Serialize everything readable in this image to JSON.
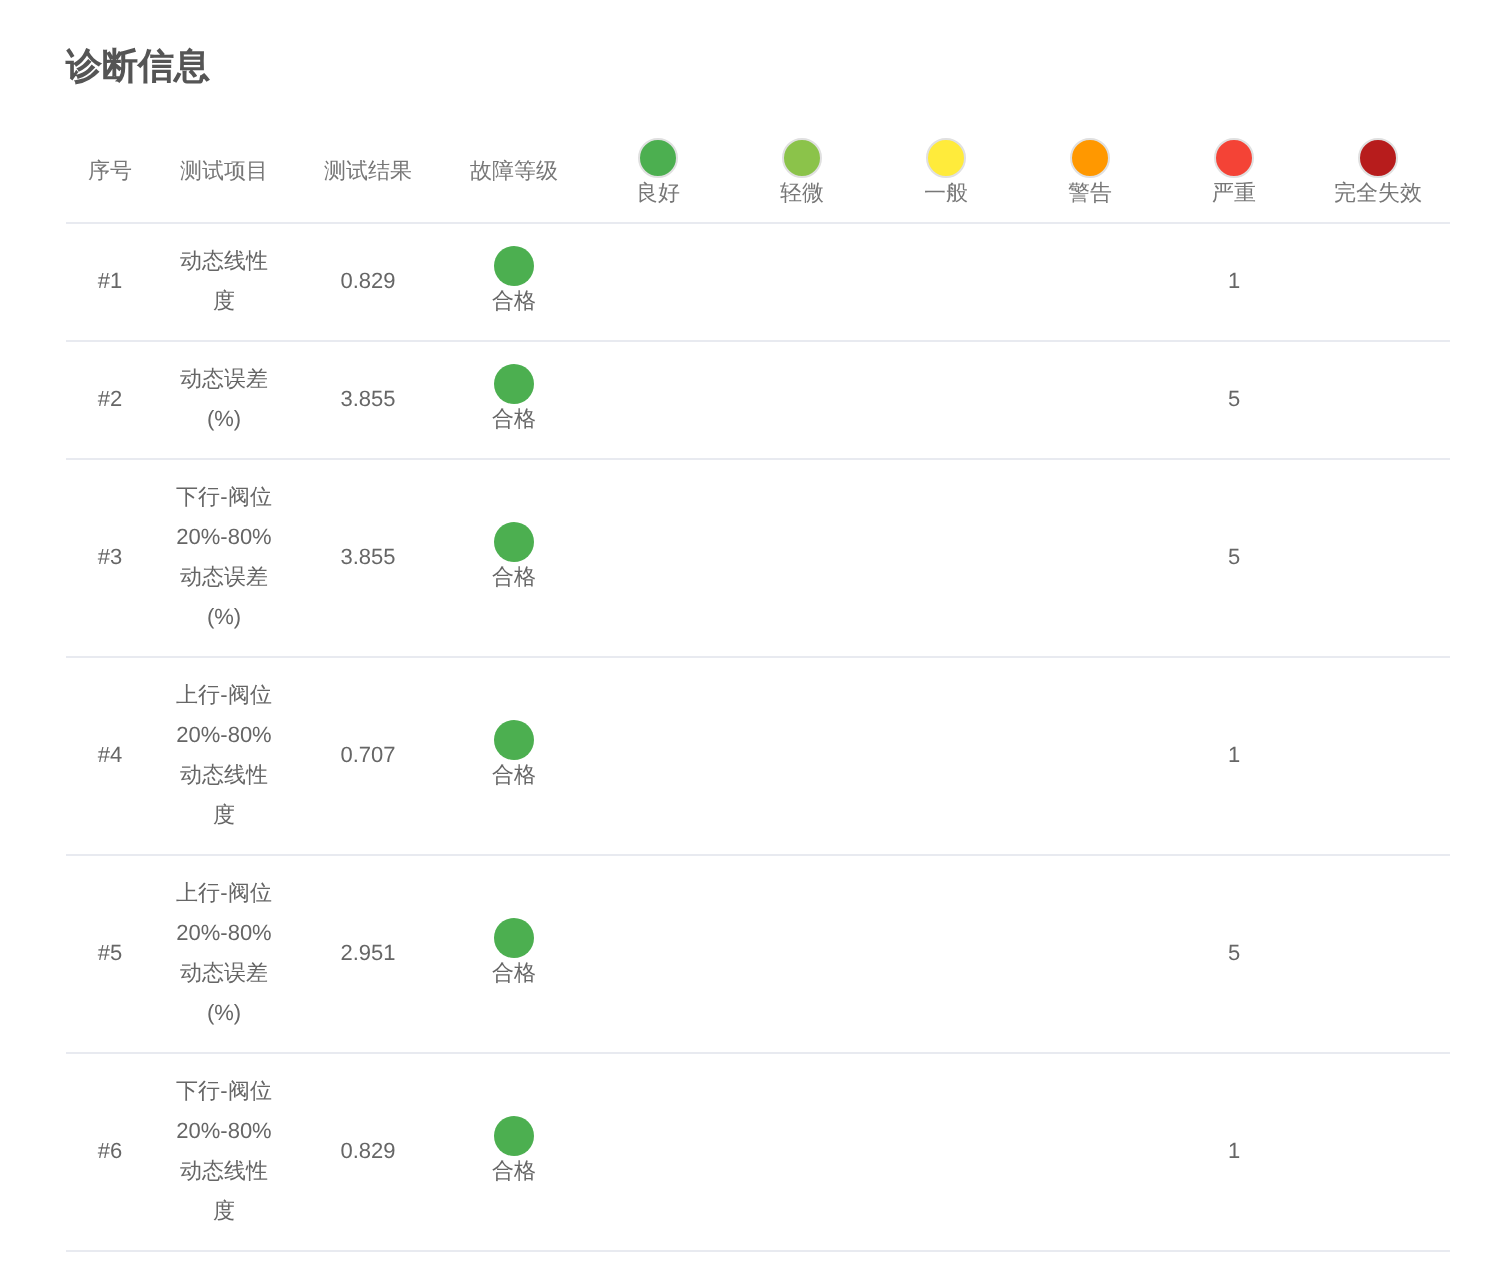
{
  "title": "诊断信息",
  "columns": [
    "序号",
    "测试项目",
    "测试结果",
    "故障等级"
  ],
  "levels": [
    {
      "kind": "good",
      "label": "良好",
      "color": "#4caf50"
    },
    {
      "kind": "slight",
      "label": "轻微",
      "color": "#8bc34a"
    },
    {
      "kind": "normal",
      "label": "一般",
      "color": "#ffeb3b"
    },
    {
      "kind": "warning",
      "label": "警告",
      "color": "#ff9800"
    },
    {
      "kind": "severe",
      "label": "严重",
      "color": "#f44336"
    },
    {
      "kind": "failure",
      "label": "完全失效",
      "color": "#b71c1c"
    }
  ],
  "rows": [
    {
      "index": "#1",
      "item": "动态线性度",
      "result": "0.829",
      "grade": {
        "label": "合格",
        "color": "#4caf50"
      },
      "counts": {
        "severe": "1"
      }
    },
    {
      "index": "#2",
      "item": "动态误差(%)",
      "result": "3.855",
      "grade": {
        "label": "合格",
        "color": "#4caf50"
      },
      "counts": {
        "severe": "5"
      }
    },
    {
      "index": "#3",
      "item": "下行-阀位20%-80%动态误差(%)",
      "result": "3.855",
      "grade": {
        "label": "合格",
        "color": "#4caf50"
      },
      "counts": {
        "severe": "5"
      }
    },
    {
      "index": "#4",
      "item": "上行-阀位20%-80%动态线性度",
      "result": "0.707",
      "grade": {
        "label": "合格",
        "color": "#4caf50"
      },
      "counts": {
        "severe": "1"
      }
    },
    {
      "index": "#5",
      "item": "上行-阀位20%-80%动态误差(%)",
      "result": "2.951",
      "grade": {
        "label": "合格",
        "color": "#4caf50"
      },
      "counts": {
        "severe": "5"
      }
    },
    {
      "index": "#6",
      "item": "下行-阀位20%-80%动态线性度",
      "result": "0.829",
      "grade": {
        "label": "合格",
        "color": "#4caf50"
      },
      "counts": {
        "severe": "1"
      }
    }
  ]
}
